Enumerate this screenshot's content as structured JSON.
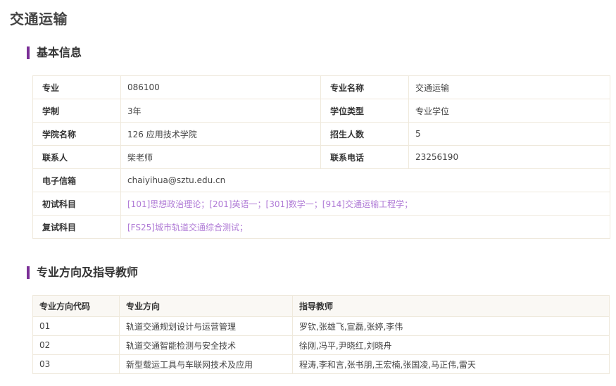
{
  "page_title": "交通运输",
  "basic_info": {
    "section_title": "基本信息",
    "rows": [
      {
        "label1": "专业",
        "value1": "086100",
        "label2": "专业名称",
        "value2": "交通运输"
      },
      {
        "label1": "学制",
        "value1": "3年",
        "label2": "学位类型",
        "value2": "专业学位"
      },
      {
        "label1": "学院名称",
        "value1": "126 应用技术学院",
        "label2": "招生人数",
        "value2": "5"
      },
      {
        "label1": "联系人",
        "value1": "柴老师",
        "label2": "联系电话",
        "value2": "23256190"
      }
    ],
    "email": {
      "label": "电子信箱",
      "value": "chaiyihua@sztu.edu.cn"
    },
    "initial_exam": {
      "label": "初试科目",
      "value": "[101]思想政治理论；[201]英语一；[301]数学一；[914]交通运输工程学；"
    },
    "retest": {
      "label": "复试科目",
      "value": "[FS25]城市轨道交通综合测试；"
    }
  },
  "directions": {
    "section_title": "专业方向及指导教师",
    "headers": [
      "专业方向代码",
      "专业方向",
      "指导教师"
    ],
    "rows": [
      {
        "code": "01",
        "direction": "轨道交通规划设计与运营管理",
        "teachers": "罗钦,张雄飞,宣磊,张婷,李伟"
      },
      {
        "code": "02",
        "direction": "轨道交通智能检测与安全技术",
        "teachers": "徐刚,冯平,尹晓红,刘晓舟"
      },
      {
        "code": "03",
        "direction": "新型载运工具与车联网技术及应用",
        "teachers": "程涛,李和言,张书朋,王宏楠,张国凌,马正伟,雷天"
      }
    ]
  },
  "colors": {
    "accent": "#7b2f97",
    "subject_text": "#b07bd6",
    "border": "#efe9dc",
    "header_bg": "#faf8f4"
  }
}
